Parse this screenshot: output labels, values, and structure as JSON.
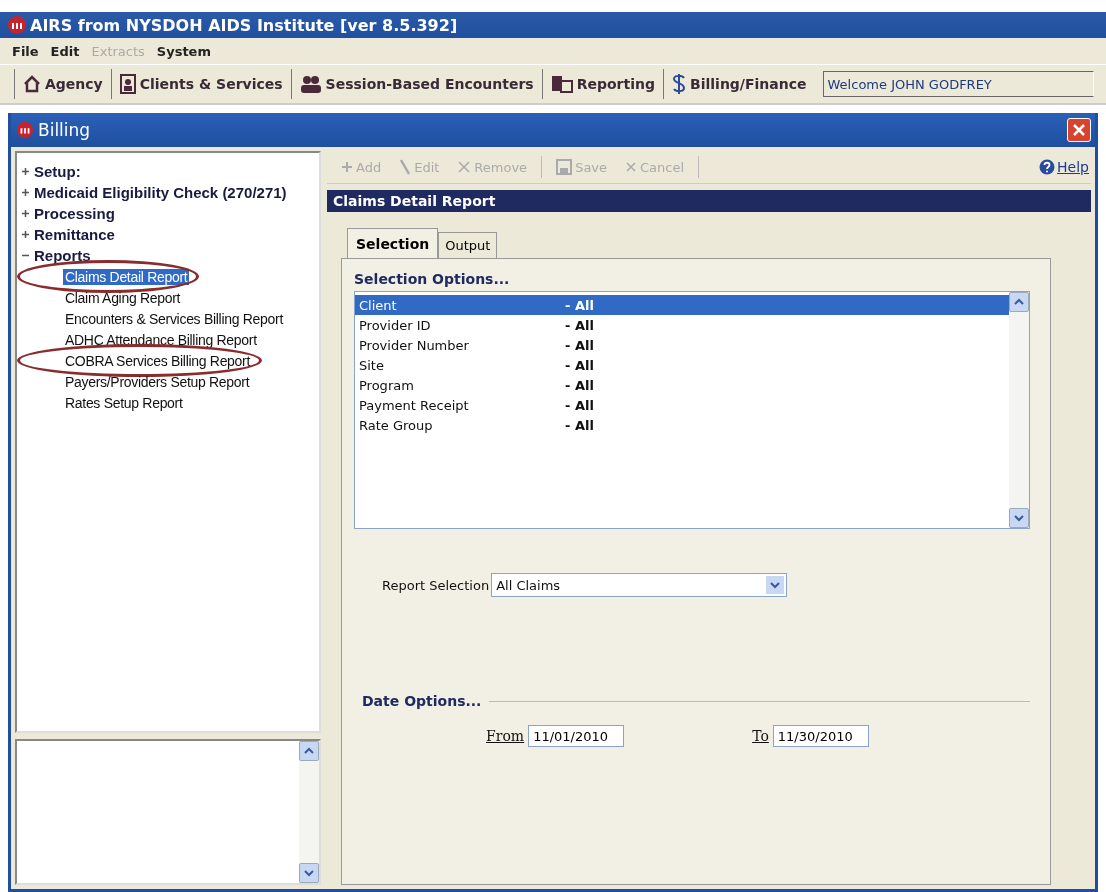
{
  "app": {
    "title": "AIRS from NYSDOH AIDS Institute [ver 8.5.392]"
  },
  "menu": [
    {
      "label": "File",
      "disabled": false
    },
    {
      "label": "Edit",
      "disabled": false
    },
    {
      "label": "Extracts",
      "disabled": true
    },
    {
      "label": "System",
      "disabled": false
    }
  ],
  "modules": [
    {
      "label": "Agency",
      "kind": "house"
    },
    {
      "label": "Clients & Services",
      "kind": "person"
    },
    {
      "label": "Session-Based Encounters",
      "kind": "group"
    },
    {
      "label": "Reporting",
      "kind": "report"
    },
    {
      "label": "Billing/Finance",
      "kind": "dollar"
    }
  ],
  "welcome": "Welcome JOHN GODFREY",
  "window": {
    "title": "Billing"
  },
  "tree": [
    {
      "label": "Setup:",
      "expanded": false
    },
    {
      "label": "Medicaid Eligibility Check (270/271)",
      "expanded": false
    },
    {
      "label": "Processing",
      "expanded": false
    },
    {
      "label": "Remittance",
      "expanded": false
    },
    {
      "label": "Reports",
      "expanded": true,
      "children": [
        {
          "label": "Claims Detail Report",
          "selected": true,
          "circled": true
        },
        {
          "label": "Claim Aging Report",
          "selected": false,
          "circled": false
        },
        {
          "label": "Encounters & Services Billing Report",
          "selected": false,
          "circled": false
        },
        {
          "label": "ADHC Attendance Billing Report",
          "selected": false,
          "circled": false
        },
        {
          "label": "COBRA Services Billing Report",
          "selected": false,
          "circled": true
        },
        {
          "label": "Payers/Providers Setup Report",
          "selected": false,
          "circled": false
        },
        {
          "label": "Rates Setup Report",
          "selected": false,
          "circled": false
        }
      ]
    }
  ],
  "toolbar": [
    {
      "label": "Add",
      "kind": "add",
      "disabled": true
    },
    {
      "label": "Edit",
      "kind": "edit",
      "disabled": true
    },
    {
      "label": "Remove",
      "kind": "remove",
      "disabled": true
    },
    {
      "label": "Save",
      "kind": "save",
      "disabled": true
    },
    {
      "label": "Cancel",
      "kind": "cancel",
      "disabled": true
    }
  ],
  "help": "Help",
  "panel_title": "Claims Detail Report",
  "tabs": [
    {
      "label": "Selection",
      "selected": true
    },
    {
      "label": "Output",
      "selected": false
    }
  ],
  "selection_options": {
    "heading": "Selection Options...",
    "rows": [
      {
        "name": "Client",
        "value": "- All",
        "selected": true
      },
      {
        "name": "Provider ID",
        "value": "- All",
        "selected": false
      },
      {
        "name": "Provider Number",
        "value": "- All",
        "selected": false
      },
      {
        "name": "Site",
        "value": "- All",
        "selected": false
      },
      {
        "name": "Program",
        "value": "- All",
        "selected": false
      },
      {
        "name": "Payment Receipt",
        "value": "- All",
        "selected": false
      },
      {
        "name": "Rate Group",
        "value": "- All",
        "selected": false
      }
    ]
  },
  "report_selection": {
    "label": "Report Selection",
    "value": "All Claims"
  },
  "date_options": {
    "heading": "Date Options...",
    "from": {
      "label": "From",
      "value": "11/01/2010"
    },
    "to": {
      "label": "To",
      "value": "11/30/2010"
    }
  }
}
